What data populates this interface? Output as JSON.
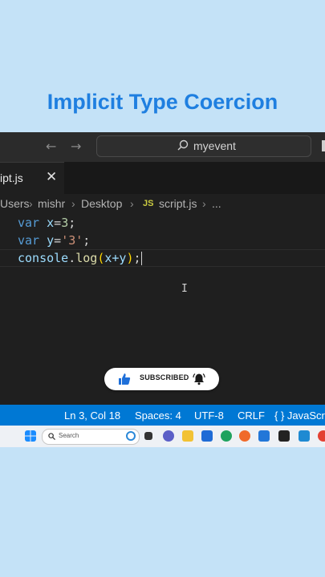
{
  "overlay": {
    "title": "Implicit Type Coercion"
  },
  "titlebar": {
    "search_text": "myevent"
  },
  "tab": {
    "label": "ipt.js",
    "close_glyph": "✕"
  },
  "breadcrumb": {
    "items": [
      "Users",
      "mishr",
      "Desktop",
      "script.js",
      "..."
    ],
    "js_badge": "JS"
  },
  "editor": {
    "lines": [
      {
        "kw": "var",
        "id": "x",
        "op": "=",
        "val": "3",
        "end": ";"
      },
      {
        "kw": "var",
        "id": "y",
        "op": "=",
        "val": "'3'",
        "end": ";"
      },
      {
        "obj": "console",
        "dot": ".",
        "fn": "log",
        "open": "(",
        "arg": "x+y",
        "close": ")",
        "end": ";"
      }
    ]
  },
  "subscribe": {
    "label": "SUBSCRIBED"
  },
  "statusbar": {
    "position": "Ln 3, Col 18",
    "spaces": "Spaces: 4",
    "encoding": "UTF-8",
    "eol": "CRLF",
    "language": "{ } JavaScr"
  },
  "taskbar": {
    "search_placeholder": "Search",
    "icons": [
      "start-icon",
      "search-icon",
      "copilot-icon",
      "task-view-icon",
      "meet-icon",
      "file-explorer-icon",
      "store-icon",
      "edge-icon",
      "outlook-icon",
      "mail-icon",
      "photos-icon",
      "media-icon",
      "vscode-icon",
      "chrome-icon"
    ]
  },
  "colors": {
    "accent": "#0078d4",
    "title": "#1f7fe0",
    "background": "#c4e2f7",
    "editor_bg": "#1f1f1f"
  }
}
